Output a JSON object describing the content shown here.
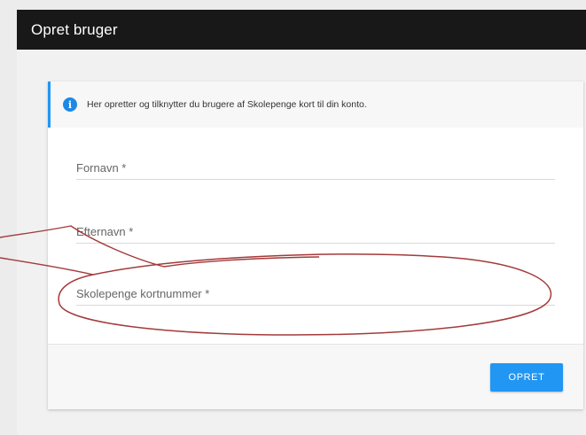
{
  "header": {
    "title": "Opret bruger"
  },
  "info": {
    "icon": "info-icon",
    "text": "Her opretter og tilknytter du brugere af Skolepenge kort til din konto."
  },
  "form": {
    "fields": [
      {
        "label": "Fornavn *"
      },
      {
        "label": "Efternavn *"
      },
      {
        "label": "Skolepenge kortnummer *"
      }
    ],
    "submit_label": "OPRET"
  },
  "colors": {
    "accent": "#2196f3",
    "header_bg": "#181818",
    "annotation": "#a33a3a"
  }
}
